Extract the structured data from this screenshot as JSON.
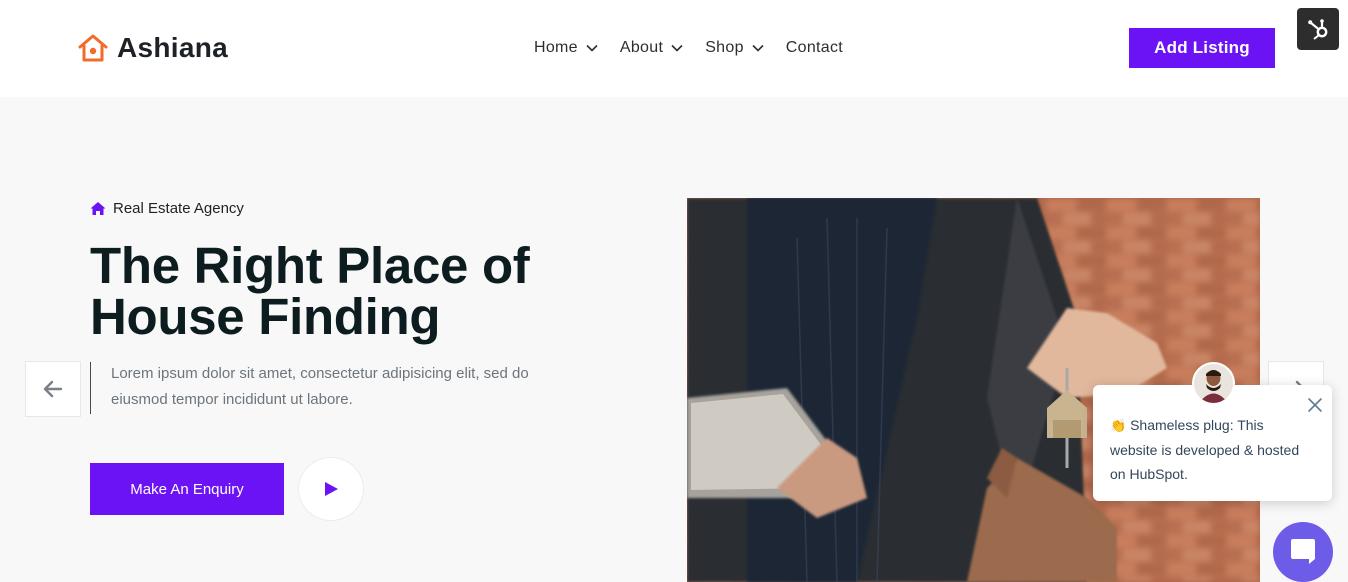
{
  "brand": {
    "name": "Ashiana",
    "accent": "#6c13f5",
    "logo_color": "#f26b2a"
  },
  "nav": {
    "items": [
      {
        "label": "Home",
        "has_dropdown": true
      },
      {
        "label": "About",
        "has_dropdown": true
      },
      {
        "label": "Shop",
        "has_dropdown": true
      },
      {
        "label": "Contact",
        "has_dropdown": false
      }
    ]
  },
  "header": {
    "cta_label": "Add Listing"
  },
  "hero": {
    "tag": "Real Estate Agency",
    "title_line1": "The Right Place of",
    "title_line2": "House Finding",
    "description": "Lorem ipsum dolor sit amet, consectetur adipisicing elit, sed do eiusmod tempor incididunt ut labore.",
    "primary_cta": "Make An Enquiry",
    "play_icon": "play-icon",
    "prev_icon": "arrow-left-icon",
    "next_icon": "arrow-right-icon"
  },
  "chat": {
    "emoji": "👏",
    "message": "Shameless plug: This website is developed & hosted on HubSpot.",
    "close_icon": "close-icon",
    "launcher_icon": "chat-bubble-icon"
  },
  "hubspot": {
    "icon": "hubspot-sprocket-icon"
  }
}
